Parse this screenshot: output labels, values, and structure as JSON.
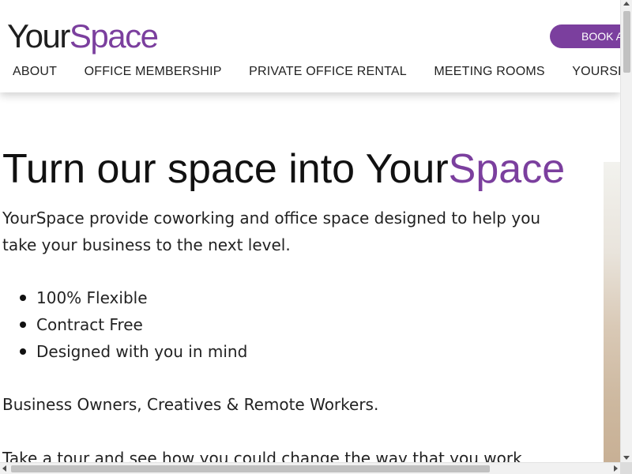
{
  "brand": {
    "logo_part1": "Your",
    "logo_part2": "Space",
    "accent_color": "#7b3f9e"
  },
  "header": {
    "book_button": "BOOK A TOUR"
  },
  "nav": {
    "items": [
      {
        "label": "ABOUT"
      },
      {
        "label": "OFFICE MEMBERSHIP"
      },
      {
        "label": "PRIVATE OFFICE RENTAL"
      },
      {
        "label": "MEETING ROOMS"
      },
      {
        "label": "YOURSPACE NETWORK"
      }
    ]
  },
  "hero": {
    "title_part1": "Turn our space into Your",
    "title_part2": "Space",
    "intro_line1": "YourSpace provide coworking and office space designed to help you",
    "intro_line2": "take your business to the next level.",
    "bullets": [
      "100% Flexible",
      "Contract Free",
      "Designed with you in mind"
    ],
    "audience": "Business Owners, Creatives & Remote Workers.",
    "tour_text": "Take a tour and see how you could change the way that you work"
  },
  "scrollbars": {
    "vertical_position": 0.02,
    "horizontal_position": 0.0
  }
}
